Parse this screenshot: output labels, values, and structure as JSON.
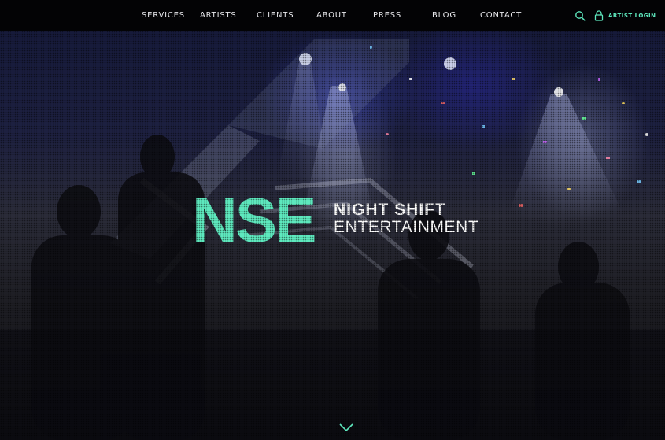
{
  "colors": {
    "accent": "#5ee8be",
    "topbar": "#030305",
    "nav_text": "#e8e8ec"
  },
  "nav": {
    "items": [
      {
        "label": "SERVICES"
      },
      {
        "label": "ARTISTS"
      },
      {
        "label": "CLIENTS"
      },
      {
        "label": "ABOUT"
      },
      {
        "label": "PRESS"
      },
      {
        "label": "BLOG"
      },
      {
        "label": "CONTACT"
      }
    ],
    "search_icon": "search-icon",
    "login_icon": "lock-icon",
    "login_label": "ARTIST LOGIN"
  },
  "hero": {
    "logo_mark": "NSE",
    "logo_line1": "NIGHT SHIFT",
    "logo_line2": "ENTERTAINMENT",
    "scroll_icon": "chevron-down-icon"
  }
}
